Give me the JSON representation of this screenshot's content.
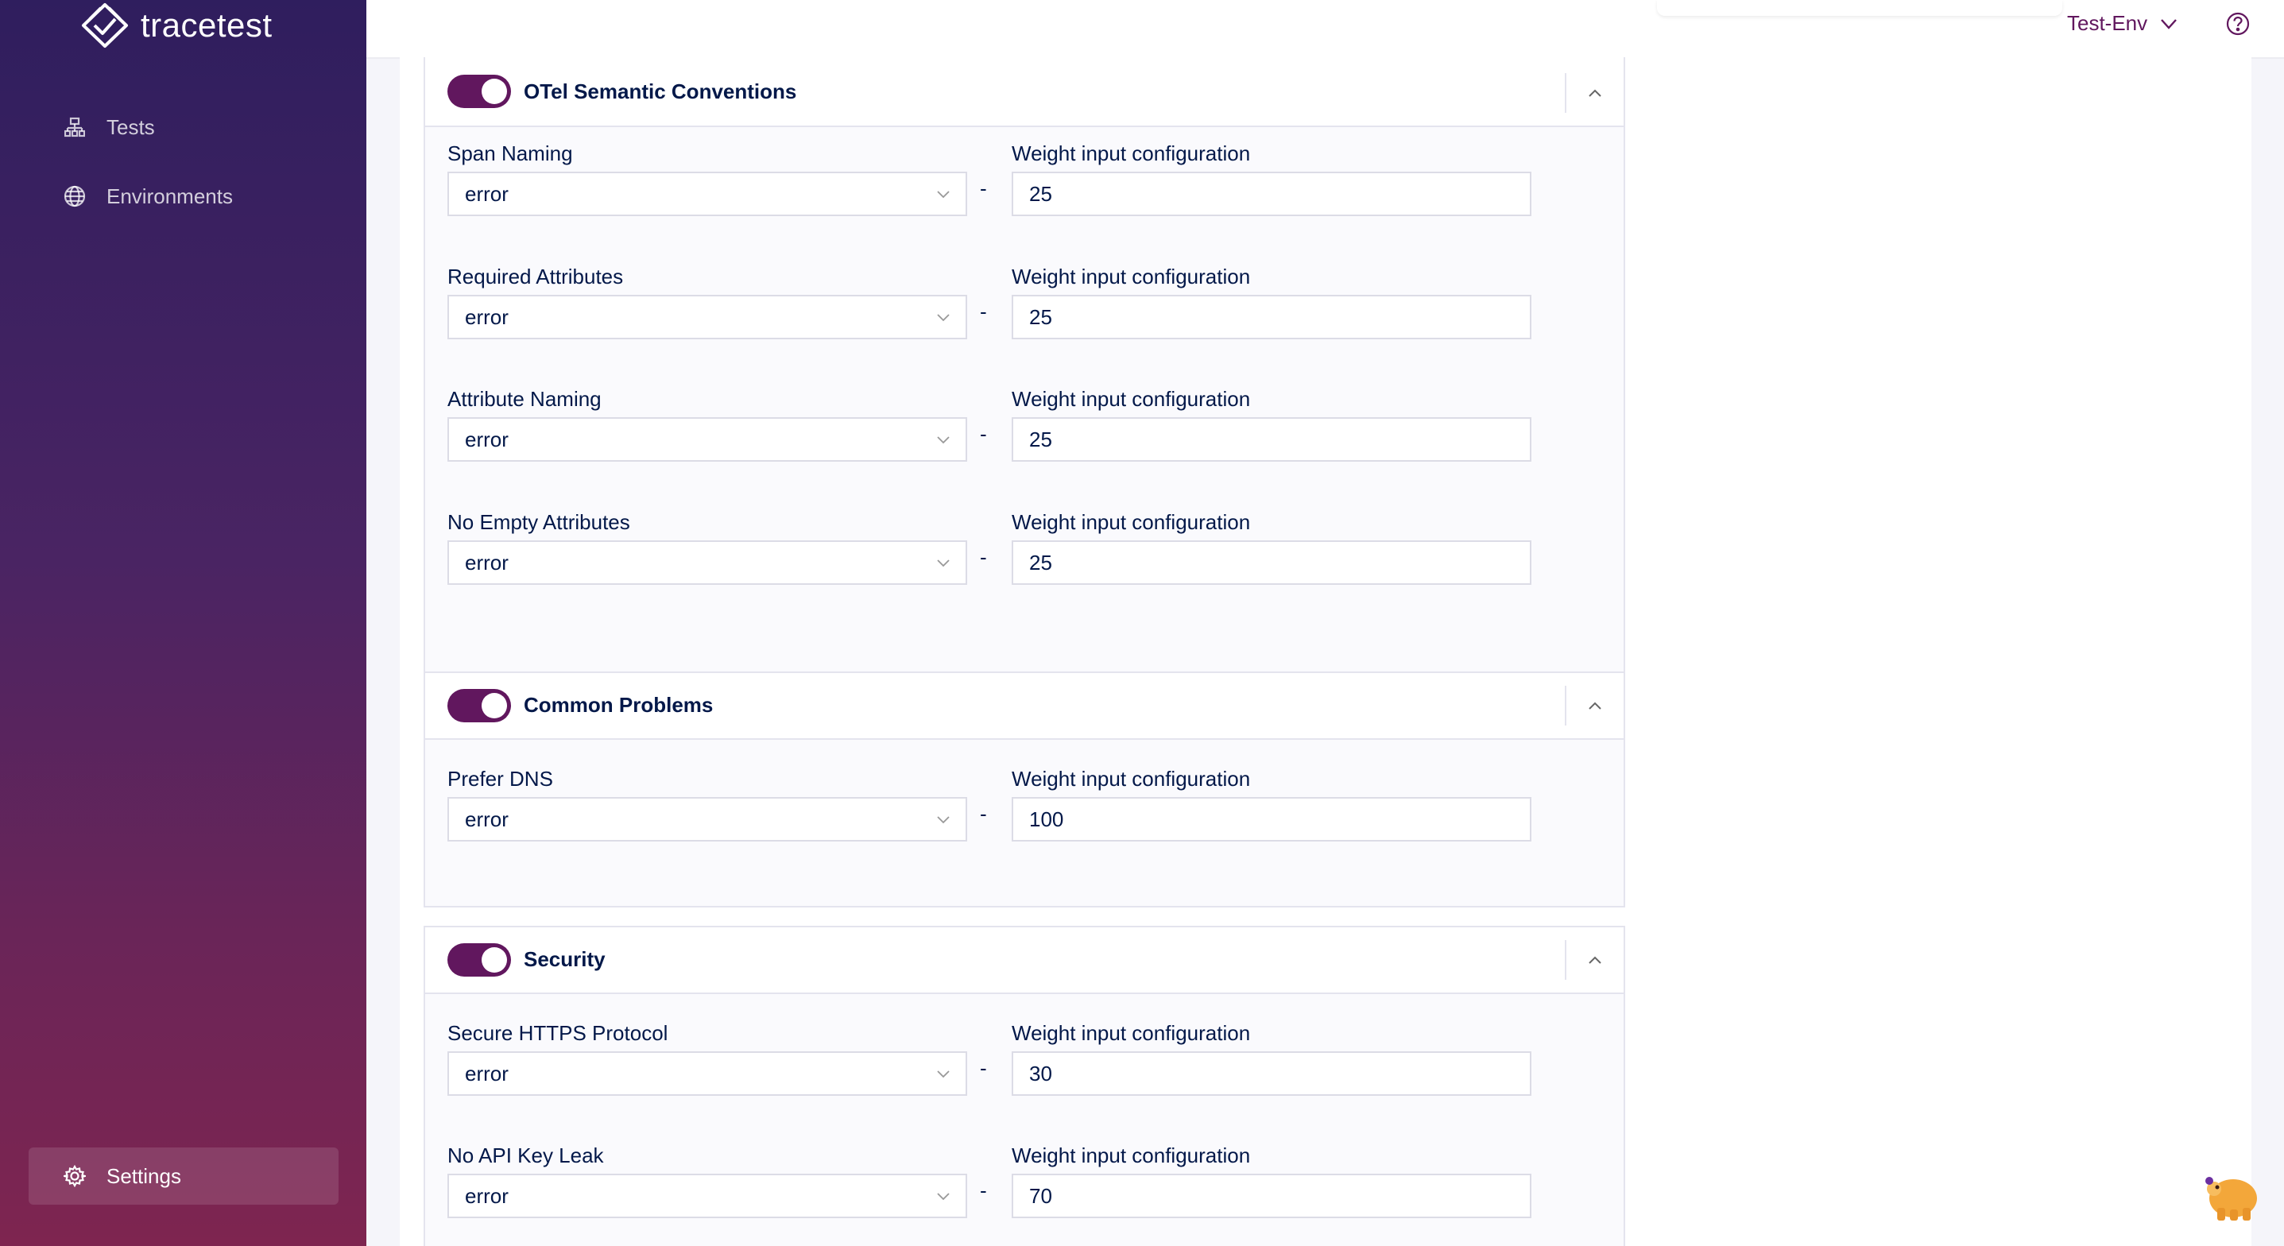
{
  "app": {
    "name": "tracetest"
  },
  "sidebar": {
    "items": [
      {
        "label": "Tests",
        "icon": "tests-icon"
      },
      {
        "label": "Environments",
        "icon": "globe-icon"
      }
    ],
    "settings": {
      "label": "Settings",
      "icon": "gear-icon"
    }
  },
  "header": {
    "environment": "Test-Env",
    "help_icon": "help-circle-icon"
  },
  "sections": [
    {
      "title": "OTel Semantic Conventions",
      "enabled": true,
      "rules": [
        {
          "name": "Span Naming",
          "level": "error",
          "weight_label": "Weight input configuration",
          "weight": "25"
        },
        {
          "name": "Required Attributes",
          "level": "error",
          "weight_label": "Weight input configuration",
          "weight": "25"
        },
        {
          "name": "Attribute Naming",
          "level": "error",
          "weight_label": "Weight input configuration",
          "weight": "25"
        },
        {
          "name": "No Empty Attributes",
          "level": "error",
          "weight_label": "Weight input configuration",
          "weight": "25"
        }
      ]
    },
    {
      "title": "Common Problems",
      "enabled": true,
      "rules": [
        {
          "name": "Prefer DNS",
          "level": "error",
          "weight_label": "Weight input configuration",
          "weight": "100"
        }
      ]
    },
    {
      "title": "Security",
      "enabled": true,
      "rules": [
        {
          "name": "Secure HTTPS Protocol",
          "level": "error",
          "weight_label": "Weight input configuration",
          "weight": "30"
        },
        {
          "name": "No API Key Leak",
          "level": "error",
          "weight_label": "Weight input configuration",
          "weight": "70"
        }
      ]
    }
  ],
  "separator": "-",
  "colors": {
    "accent": "#61175e",
    "text": "#031849",
    "sidebar_top": "#2f1e5e",
    "sidebar_bottom": "#7e2550"
  }
}
